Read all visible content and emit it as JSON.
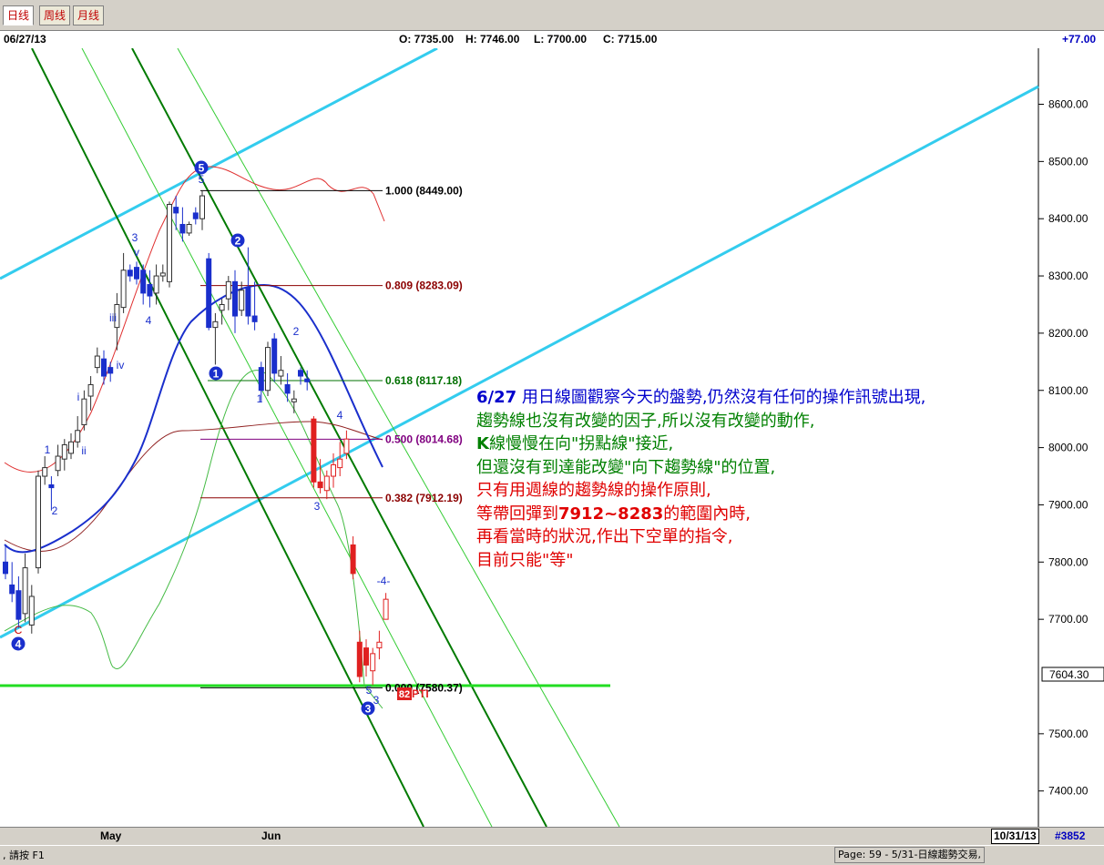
{
  "tabs": [
    "日线",
    "周线",
    "月线"
  ],
  "info": {
    "date": "06/27/13",
    "open": "O: 7735.00",
    "high": "H: 7746.00",
    "low": "L: 7700.00",
    "close": "C: 7715.00",
    "change": "+77.00"
  },
  "chart_data": {
    "type": "candlestick",
    "y_axis": {
      "ticks": [
        8600,
        8500,
        8400,
        8300,
        8200,
        8100,
        8000,
        7900,
        7800,
        7700,
        7500,
        7400
      ],
      "ylim": [
        7338,
        8690
      ],
      "last_price_label": "7604.30"
    },
    "x_labels": [
      "May",
      "Jun"
    ],
    "fib_levels": [
      {
        "ratio": "1.000",
        "value": 8449.0,
        "label": "1.000 (8449.00)",
        "color": "#000000"
      },
      {
        "ratio": "0.809",
        "value": 8283.09,
        "label": "0.809 (8283.09)",
        "color": "#8b0000"
      },
      {
        "ratio": "0.618",
        "value": 8117.18,
        "label": "0.618 (8117.18)",
        "color": "#007000"
      },
      {
        "ratio": "0.500",
        "value": 8014.68,
        "label": "0.500 (8014.68)",
        "color": "#800080"
      },
      {
        "ratio": "0.382",
        "value": 7912.19,
        "label": "0.382 (7912.19)",
        "color": "#8b0000"
      },
      {
        "ratio": "0.000",
        "value": 7580.37,
        "label": "0.000 (7580.37)",
        "color": "#000000"
      }
    ],
    "candles": [
      {
        "o": 7800,
        "h": 7830,
        "l": 7770,
        "c": 7780
      },
      {
        "o": 7760,
        "h": 7800,
        "l": 7730,
        "c": 7745
      },
      {
        "o": 7750,
        "h": 7775,
        "l": 7685,
        "c": 7700
      },
      {
        "o": 7710,
        "h": 7815,
        "l": 7695,
        "c": 7790
      },
      {
        "o": 7690,
        "h": 7760,
        "l": 7675,
        "c": 7740
      },
      {
        "o": 7790,
        "h": 7960,
        "l": 7780,
        "c": 7950
      },
      {
        "o": 7950,
        "h": 7985,
        "l": 7935,
        "c": 7965
      },
      {
        "o": 7935,
        "h": 7950,
        "l": 7890,
        "c": 7930
      },
      {
        "o": 7960,
        "h": 8005,
        "l": 7950,
        "c": 7985
      },
      {
        "o": 7980,
        "h": 8015,
        "l": 7960,
        "c": 8005
      },
      {
        "o": 7990,
        "h": 8025,
        "l": 7980,
        "c": 8010
      },
      {
        "o": 8010,
        "h": 8055,
        "l": 8000,
        "c": 8030
      },
      {
        "o": 8040,
        "h": 8100,
        "l": 8030,
        "c": 8085
      },
      {
        "o": 8090,
        "h": 8125,
        "l": 8065,
        "c": 8110
      },
      {
        "o": 8140,
        "h": 8175,
        "l": 8130,
        "c": 8160
      },
      {
        "o": 8155,
        "h": 8170,
        "l": 8110,
        "c": 8125
      },
      {
        "o": 8140,
        "h": 8150,
        "l": 8115,
        "c": 8130
      },
      {
        "o": 8210,
        "h": 8270,
        "l": 8170,
        "c": 8250
      },
      {
        "o": 8245,
        "h": 8340,
        "l": 8235,
        "c": 8310
      },
      {
        "o": 8310,
        "h": 8320,
        "l": 8290,
        "c": 8300
      },
      {
        "o": 8315,
        "h": 8325,
        "l": 8285,
        "c": 8295
      },
      {
        "o": 8310,
        "h": 8320,
        "l": 8250,
        "c": 8270
      },
      {
        "o": 8285,
        "h": 8310,
        "l": 8245,
        "c": 8265
      },
      {
        "o": 8270,
        "h": 8320,
        "l": 8250,
        "c": 8300
      },
      {
        "o": 8300,
        "h": 8320,
        "l": 8290,
        "c": 8305
      },
      {
        "o": 8290,
        "h": 8430,
        "l": 8280,
        "c": 8425
      },
      {
        "o": 8420,
        "h": 8440,
        "l": 8380,
        "c": 8410
      },
      {
        "o": 8390,
        "h": 8420,
        "l": 8360,
        "c": 8375
      },
      {
        "o": 8375,
        "h": 8395,
        "l": 8370,
        "c": 8390
      },
      {
        "o": 8410,
        "h": 8420,
        "l": 8390,
        "c": 8400
      },
      {
        "o": 8400,
        "h": 8449,
        "l": 8380,
        "c": 8440
      },
      {
        "o": 8330,
        "h": 8340,
        "l": 8205,
        "c": 8210
      },
      {
        "o": 8210,
        "h": 8235,
        "l": 8145,
        "c": 8220
      },
      {
        "o": 8240,
        "h": 8260,
        "l": 8215,
        "c": 8250
      },
      {
        "o": 8260,
        "h": 8300,
        "l": 8240,
        "c": 8290
      },
      {
        "o": 8290,
        "h": 8310,
        "l": 8200,
        "c": 8230
      },
      {
        "o": 8240,
        "h": 8290,
        "l": 8230,
        "c": 8275
      },
      {
        "o": 8280,
        "h": 8350,
        "l": 8215,
        "c": 8230
      },
      {
        "o": 8230,
        "h": 8290,
        "l": 8205,
        "c": 8220
      },
      {
        "o": 8140,
        "h": 8150,
        "l": 8080,
        "c": 8100
      },
      {
        "o": 8100,
        "h": 8185,
        "l": 8090,
        "c": 8175
      },
      {
        "o": 8190,
        "h": 8200,
        "l": 8115,
        "c": 8130
      },
      {
        "o": 8125,
        "h": 8160,
        "l": 8110,
        "c": 8135
      },
      {
        "o": 8110,
        "h": 8130,
        "l": 8080,
        "c": 8095
      },
      {
        "o": 8080,
        "h": 8100,
        "l": 8060,
        "c": 8085
      },
      {
        "o": 8135,
        "h": 8140,
        "l": 8110,
        "c": 8125
      },
      {
        "o": 8120,
        "h": 8135,
        "l": 8100,
        "c": 8115
      },
      {
        "o": 8050,
        "h": 8055,
        "l": 7930,
        "c": 7940
      },
      {
        "o": 7940,
        "h": 7980,
        "l": 7920,
        "c": 7930
      },
      {
        "o": 7925,
        "h": 7960,
        "l": 7910,
        "c": 7950
      },
      {
        "o": 7950,
        "h": 7990,
        "l": 7930,
        "c": 7970
      },
      {
        "o": 7965,
        "h": 8010,
        "l": 7950,
        "c": 7980
      },
      {
        "o": 7990,
        "h": 8030,
        "l": 7980,
        "c": 8015
      },
      {
        "o": 7830,
        "h": 7845,
        "l": 7770,
        "c": 7780
      },
      {
        "o": 7660,
        "h": 7680,
        "l": 7590,
        "c": 7600
      },
      {
        "o": 7650,
        "h": 7665,
        "l": 7600,
        "c": 7620
      },
      {
        "o": 7610,
        "h": 7650,
        "l": 7585,
        "c": 7640
      },
      {
        "o": 7650,
        "h": 7680,
        "l": 7630,
        "c": 7660
      },
      {
        "o": 7700,
        "h": 7746,
        "l": 7700,
        "c": 7735
      }
    ],
    "wave_labels": [
      {
        "text": "C",
        "color": "red"
      },
      {
        "text": "4",
        "circled": true
      },
      {
        "text": "1"
      },
      {
        "text": "2"
      },
      {
        "text": "i"
      },
      {
        "text": "ii"
      },
      {
        "text": "iii"
      },
      {
        "text": "iv"
      },
      {
        "text": "v"
      },
      {
        "text": "3"
      },
      {
        "text": "4"
      },
      {
        "text": "5"
      },
      {
        "text": "5",
        "circled": true
      },
      {
        "text": "2",
        "circled": true
      },
      {
        "text": "1",
        "circled": true
      },
      {
        "text": "1"
      },
      {
        "text": "2"
      },
      {
        "text": "3"
      },
      {
        "text": "4"
      },
      {
        "text": "-4-"
      },
      {
        "text": "5"
      },
      {
        "text": "3",
        "circled": true
      },
      {
        "text": "3"
      }
    ],
    "pti_label": "82",
    "pti_text": "PTI"
  },
  "notes": {
    "line1_date": "6/27",
    "line1_text": " 用日線圖觀察今天的盤勢,仍然沒有任何的操作訊號出現,",
    "line2": "趨勢線也沒有改變的因子,所以沒有改變的動作,",
    "line3a": "K",
    "line3b": "線慢慢在向\"拐點線\"接近,",
    "line4": "但還沒有到達能改變\"向下趨勢線\"的位置,",
    "line5": "只有用週線的趨勢線的操作原則,",
    "line6a": "等帶回彈到",
    "line6b": "7912~8283",
    "line6c": "的範圍內時,",
    "line7": "再看當時的狀況,作出下空單的指令,",
    "line8": "目前只能\"等\""
  },
  "bottom": {
    "may": "May",
    "jun": "Jun",
    "date_box": "10/31/13",
    "count": "#3852"
  },
  "status": {
    "left": ", 請按 F1",
    "right": "Page: 59 - 5/31-日線趨勢交易,"
  }
}
